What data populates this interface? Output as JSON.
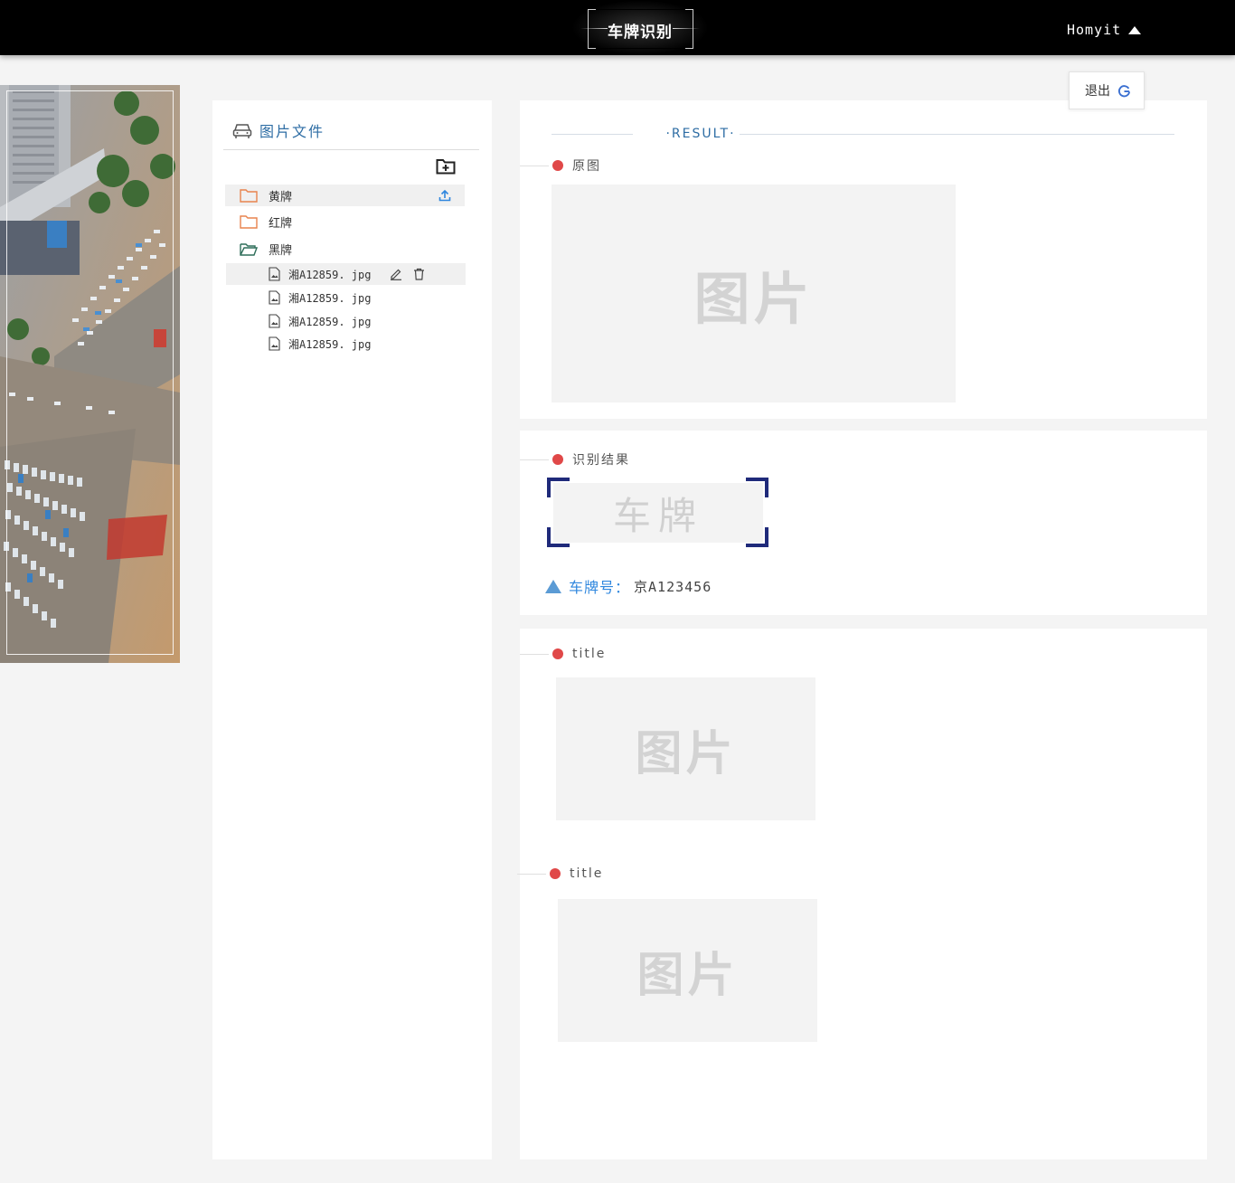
{
  "header": {
    "app_title": "车牌识别",
    "username": "Homyit"
  },
  "user_menu": {
    "logout_label": "退出"
  },
  "file_panel": {
    "title": "图片文件",
    "folders": [
      {
        "name": "黄牌",
        "state": "closed",
        "icon_color": "#e8834e"
      },
      {
        "name": "红牌",
        "state": "closed",
        "icon_color": "#e8834e"
      },
      {
        "name": "黑牌",
        "state": "open",
        "icon_color": "#2f6e5a"
      }
    ],
    "files": [
      {
        "name": "湘A12859. jpg"
      },
      {
        "name": "湘A12859. jpg"
      },
      {
        "name": "湘A12859. jpg"
      },
      {
        "name": "湘A12859. jpg"
      }
    ]
  },
  "results": {
    "header_label": "·RESULT·",
    "original": {
      "title": "原图",
      "placeholder": "图片"
    },
    "recognition": {
      "title": "识别结果",
      "plate_placeholder": "车牌",
      "plate_label": "车牌号：",
      "plate_value": "京A123456"
    },
    "section3": {
      "title": "title",
      "placeholder": "图片"
    },
    "section4": {
      "title": "title",
      "placeholder": "图片"
    }
  },
  "colors": {
    "accent_blue": "#2e6da4",
    "dot_red": "#e04848",
    "corner_navy": "#1f2a7a",
    "triangle_blue": "#5b9bd5"
  }
}
